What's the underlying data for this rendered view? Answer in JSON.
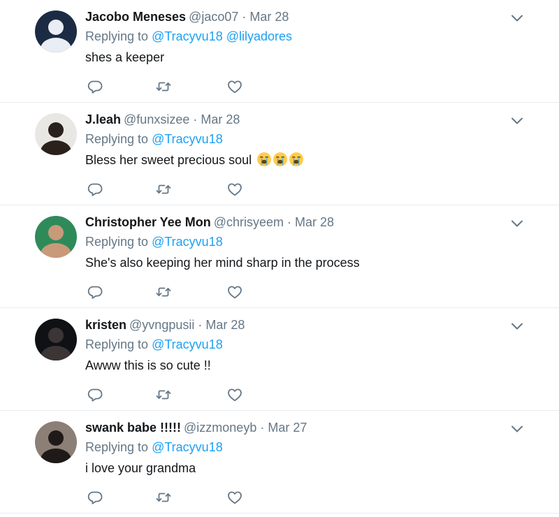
{
  "tweets": [
    {
      "name": "Jacobo Meneses",
      "handle": "@jaco07",
      "separator": "·",
      "date": "Mar 28",
      "replying_prefix": "Replying to",
      "mentions": [
        "@Tracyvu18",
        "@lilyadores"
      ],
      "text": "shes a keeper",
      "emojis": [],
      "avatar": {
        "bg": "#1c2b44",
        "fg": "#e9eef4"
      }
    },
    {
      "name": "J.leah",
      "handle": "@funxsizee",
      "separator": "·",
      "date": "Mar 28",
      "replying_prefix": "Replying to",
      "mentions": [
        "@Tracyvu18"
      ],
      "text": "Bless her sweet precious soul",
      "emojis": [
        "loudly-crying-face",
        "loudly-crying-face",
        "loudly-crying-face"
      ],
      "avatar": {
        "bg": "#e9e7e4",
        "fg": "#2a211c"
      }
    },
    {
      "name": "Christopher Yee Mon",
      "handle": "@chrisyeem",
      "separator": "·",
      "date": "Mar 28",
      "replying_prefix": "Replying to",
      "mentions": [
        "@Tracyvu18"
      ],
      "text": "She's also keeping her mind sharp in the process",
      "emojis": [],
      "avatar": {
        "bg": "#2f8a5a",
        "fg": "#c99a79"
      }
    },
    {
      "name": "kristen",
      "handle": "@yvngpusii",
      "separator": "·",
      "date": "Mar 28",
      "replying_prefix": "Replying to",
      "mentions": [
        "@Tracyvu18"
      ],
      "text": "Awww this is so cute !!",
      "emojis": [],
      "avatar": {
        "bg": "#101114",
        "fg": "#3b3536"
      }
    },
    {
      "name": "swank babe !!!!!",
      "handle": "@izzmoneyb",
      "separator": "·",
      "date": "Mar 27",
      "replying_prefix": "Replying to",
      "mentions": [
        "@Tracyvu18"
      ],
      "text": "i love your grandma",
      "emojis": [],
      "avatar": {
        "bg": "#8b7f76",
        "fg": "#1f1a18"
      }
    }
  ],
  "colors": {
    "link": "#1da1f2",
    "secondary_text": "#657786",
    "primary_text": "#14171a",
    "divider": "#e6ecf0",
    "action_icon": "#657786"
  },
  "icons": {
    "menu": "chevron-down-icon",
    "reply": "reply-icon",
    "retweet": "retweet-icon",
    "like": "heart-icon"
  }
}
